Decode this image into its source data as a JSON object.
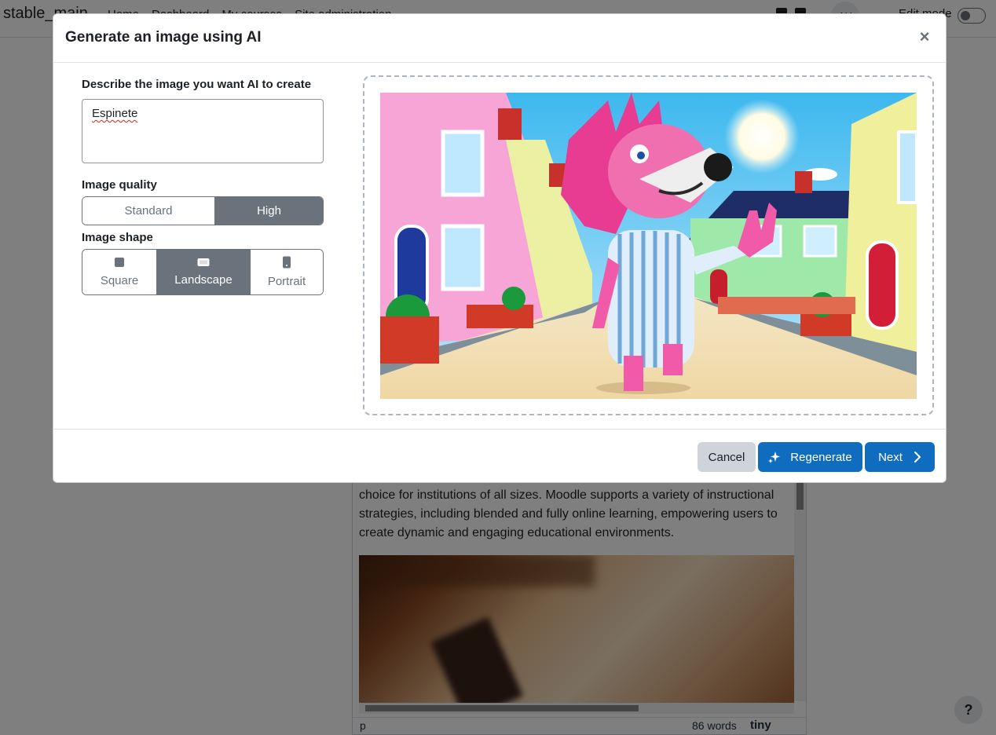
{
  "navbar": {
    "brand": "stable_main",
    "links": [
      "Home",
      "Dashboard",
      "My courses",
      "Site administration"
    ],
    "avatar_initials": "AU",
    "edit_mode_label": "Edit mode"
  },
  "editor": {
    "text": "choice for institutions of all sizes. Moodle supports a variety of instructional strategies, including blended and fully online learning, empowering users to create dynamic and engaging educational environments.",
    "status_path": "p",
    "word_count": "86 words",
    "brand": "tiny"
  },
  "help_label": "?",
  "modal": {
    "title": "Generate an image using AI",
    "close_symbol": "×",
    "prompt_label": "Describe the image you want AI to create",
    "prompt_value": "Espinete",
    "quality_label": "Image quality",
    "quality_options": [
      "Standard",
      "High"
    ],
    "quality_selected": "High",
    "shape_label": "Image shape",
    "shape_options": [
      "Square",
      "Landscape",
      "Portrait"
    ],
    "shape_selected": "Landscape",
    "buttons": {
      "cancel": "Cancel",
      "regenerate": "Regenerate",
      "next": "Next"
    }
  },
  "colors": {
    "primary": "#0f6cbf",
    "secondary": "#6a737b",
    "cancel_bg": "#ced4da"
  },
  "icons": {
    "close": "close-icon",
    "regenerate": "sparkles-icon",
    "next": "chevron-right-icon",
    "square": "square-shape-icon",
    "landscape": "landscape-shape-icon",
    "portrait": "portrait-shape-icon"
  }
}
